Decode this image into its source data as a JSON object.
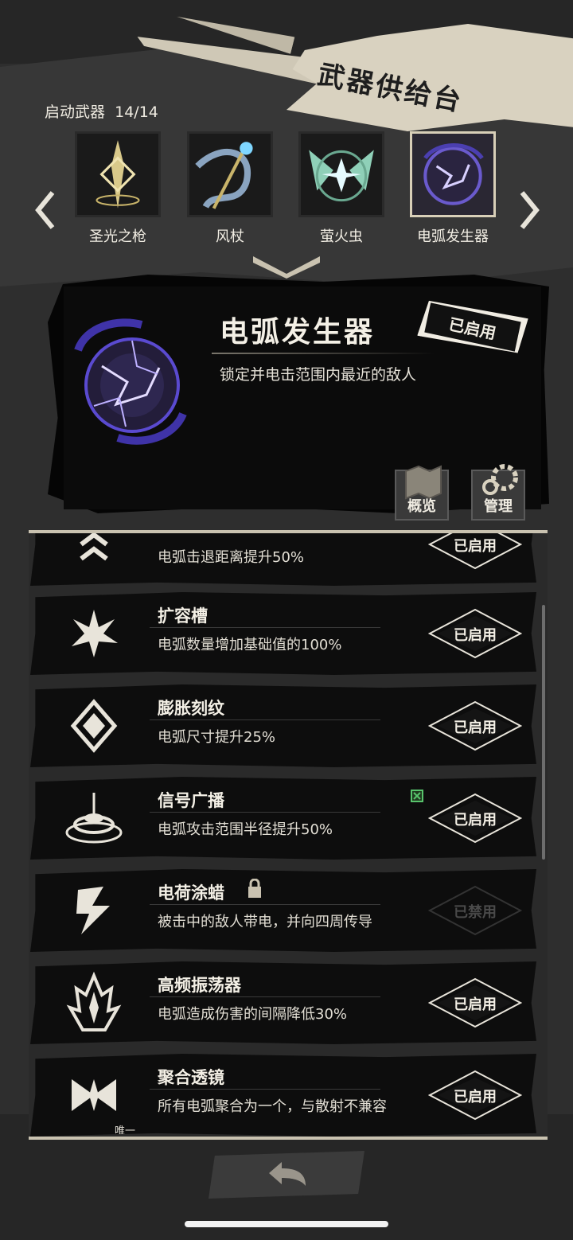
{
  "header": {
    "title": "武器供给台",
    "startup_label": "启动武器",
    "startup_count": "14/14"
  },
  "carousel": {
    "weapons": [
      {
        "label": "圣光之枪",
        "icon": "holy-spear-icon",
        "selected": false
      },
      {
        "label": "风杖",
        "icon": "wind-staff-icon",
        "selected": false
      },
      {
        "label": "萤火虫",
        "icon": "firefly-icon",
        "selected": false
      },
      {
        "label": "电弧发生器",
        "icon": "arc-generator-icon",
        "selected": true
      }
    ]
  },
  "detail": {
    "name": "电弧发生器",
    "description": "锁定并电击范围内最近的敌人",
    "status_stamp": "已启用",
    "overview_label": "概览",
    "manage_label": "管理"
  },
  "upgrades": [
    {
      "title": "",
      "desc": "电弧击退距离提升50%",
      "toggle": "已启用",
      "enabled": true,
      "icon": "chevrons-up-icon"
    },
    {
      "title": "扩容槽",
      "desc": "电弧数量增加基础值的100%",
      "toggle": "已启用",
      "enabled": true,
      "icon": "burst-icon"
    },
    {
      "title": "膨胀刻纹",
      "desc": "电弧尺寸提升25%",
      "toggle": "已启用",
      "enabled": true,
      "icon": "diamond-rune-icon"
    },
    {
      "title": "信号广播",
      "desc": "电弧攻击范围半径提升50%",
      "toggle": "已启用",
      "enabled": true,
      "icon": "signal-tower-icon"
    },
    {
      "title": "电荷涂蜡",
      "desc": "被击中的敌人带电，并向四周传导",
      "toggle": "已禁用",
      "enabled": false,
      "icon": "lightning-icon"
    },
    {
      "title": "高频振荡器",
      "desc": "电弧造成伤害的间隔降低30%",
      "toggle": "已启用",
      "enabled": true,
      "icon": "flame-crystal-icon"
    },
    {
      "title": "聚合透镜",
      "desc": "所有电弧聚合为一个，与散射不兼容",
      "toggle": "已启用",
      "enabled": true,
      "icon": "lens-icon",
      "tag": "唯一"
    }
  ],
  "colors": {
    "accent": "#d9d2c0",
    "panel": "#0b0b0b",
    "orb": "#6a5acd",
    "badge_green": "#58c36c"
  }
}
